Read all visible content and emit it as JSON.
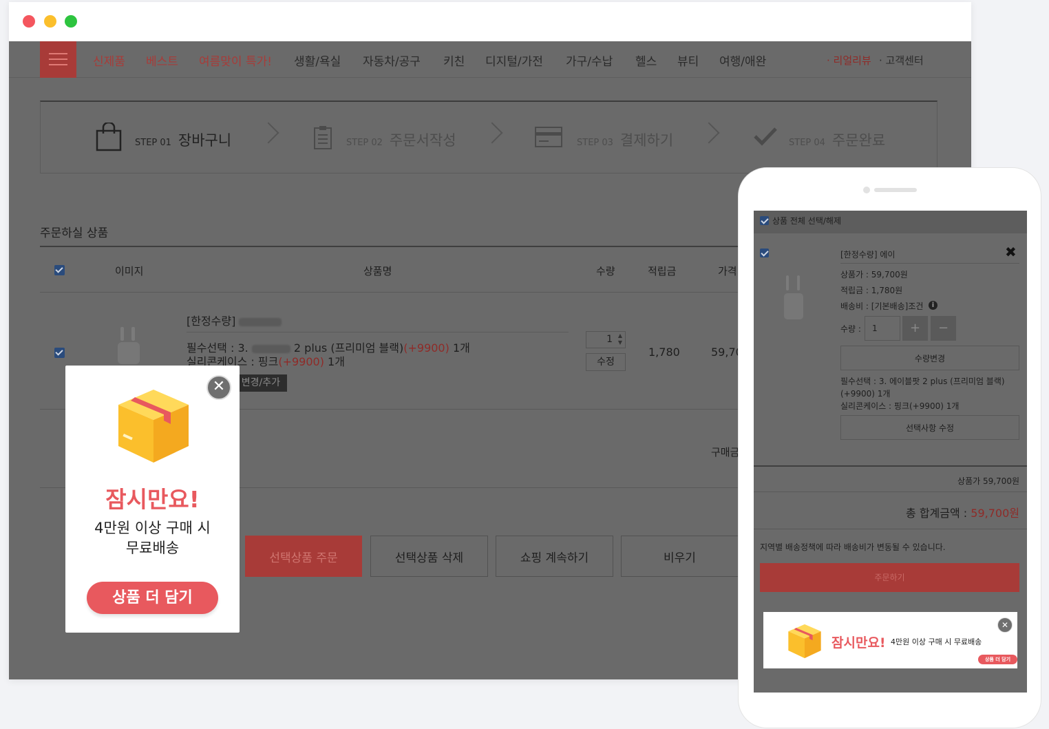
{
  "nav": {
    "items": [
      "신제품",
      "베스트",
      "여름맞이 특가!",
      "생활/욕실",
      "자동차/공구",
      "키친",
      "디지털/가전",
      "가구/수납",
      "헬스",
      "뷰티",
      "여행/애완"
    ],
    "right_review": "· 리얼리뷰",
    "right_center": "· 고객센터"
  },
  "steps": [
    {
      "label": "STEP 01",
      "name": "장바구니"
    },
    {
      "label": "STEP 02",
      "name": "주문서작성"
    },
    {
      "label": "STEP 03",
      "name": "결제하기"
    },
    {
      "label": "STEP 04",
      "name": "주문완료"
    }
  ],
  "cart": {
    "title": "주문하실 상품",
    "headers": {
      "image": "이미지",
      "name": "상품명",
      "qty": "수량",
      "points": "적립금",
      "price": "가격"
    },
    "item": {
      "name_prefix": "[한정수량]",
      "option1_prefix": "필수선택 : 3.",
      "option1_suffix": "2 plus (프리미엄 블랙)",
      "option1_extra": "(+9900)",
      "option1_count": "1개",
      "option2_prefix": "실리콘케이스 : 핑크",
      "option2_extra": "(+9900)",
      "option2_count": "1개",
      "change_label": "변경/추가",
      "qty_value": "1",
      "modify_label": "수정",
      "points": "1,780",
      "price": "59,70"
    },
    "summary_label": "구매금"
  },
  "buttons": {
    "order_selected": "선택상품 주문",
    "delete_selected": "선택상품 삭제",
    "continue": "쇼핑 계속하기",
    "empty": "비우기"
  },
  "popup": {
    "title": "잠시만요!",
    "line1": "4만원 이상 구매 시",
    "line2": "무료배송",
    "cta": "상품 더 담기"
  },
  "mobile": {
    "select_all": "상품 전체 선택/해제",
    "item_name": "[한정수량] 에이",
    "price": "상품가 : 59,700원",
    "points": "적립금 : 1,780원",
    "shipping": "배송비 : [기본배송]조건",
    "qty_label": "수량 :",
    "qty_value": "1",
    "qty_change": "수량변경",
    "option_line1": "필수선택 : 3. 에이블팟 2 plus (프리미엄 블랙)",
    "option_line2": "(+9900) 1개",
    "option_line3": "실리콘케이스 : 핑크(+9900) 1개",
    "option_edit": "선택사항 수정",
    "subtotal": "상품가 59,700원",
    "total_label": "총 합계금액 :",
    "total_value": "59,700원",
    "notice": "지역별 배송정책에 따라 배송비가 변동될 수 있습니다.",
    "order_button": "주문하기",
    "popup_title": "잠시만요!",
    "popup_text": "4만원 이상 구매 시 무료배송",
    "popup_cta": "상품 더 담기"
  },
  "colors": {
    "accent": "#e8595e",
    "dim_overlay": "#6a6a6a",
    "title_red": "#e8595e"
  }
}
